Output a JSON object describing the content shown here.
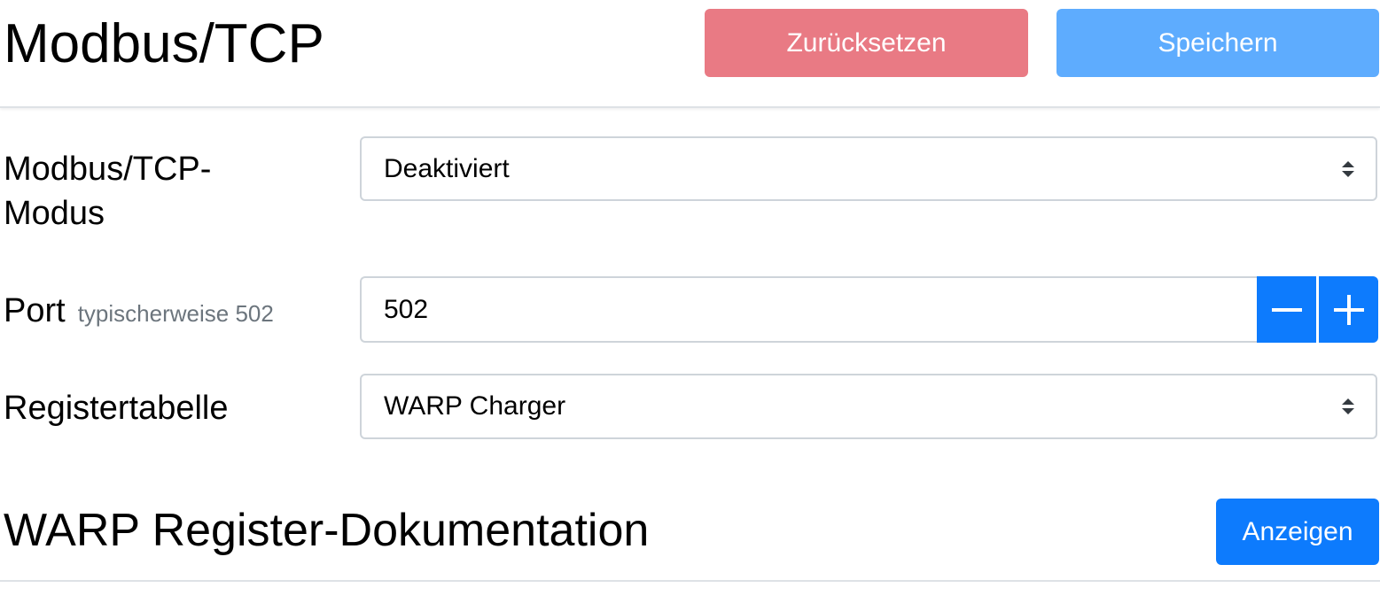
{
  "header": {
    "title": "Modbus/TCP",
    "reset_label": "Zurücksetzen",
    "save_label": "Speichern"
  },
  "form": {
    "mode": {
      "label": "Modbus/TCP-\nModus",
      "label_line1": "Modbus/TCP-",
      "label_line2": "Modus",
      "value": "Deaktiviert"
    },
    "port": {
      "label": "Port",
      "hint": "typischerweise 502",
      "value": "502"
    },
    "table": {
      "label": "Registertabelle",
      "value": "WARP Charger"
    }
  },
  "docs": {
    "title": "WARP Register-Dokumentation",
    "show_label": "Anzeigen"
  },
  "colors": {
    "reset_button": "#e97a84",
    "save_button": "#5eacfe",
    "primary": "#0d7bfd",
    "border": "#ced4da"
  },
  "icons": {
    "select": "select-arrows-icon",
    "minus": "minus-icon",
    "plus": "plus-icon"
  }
}
